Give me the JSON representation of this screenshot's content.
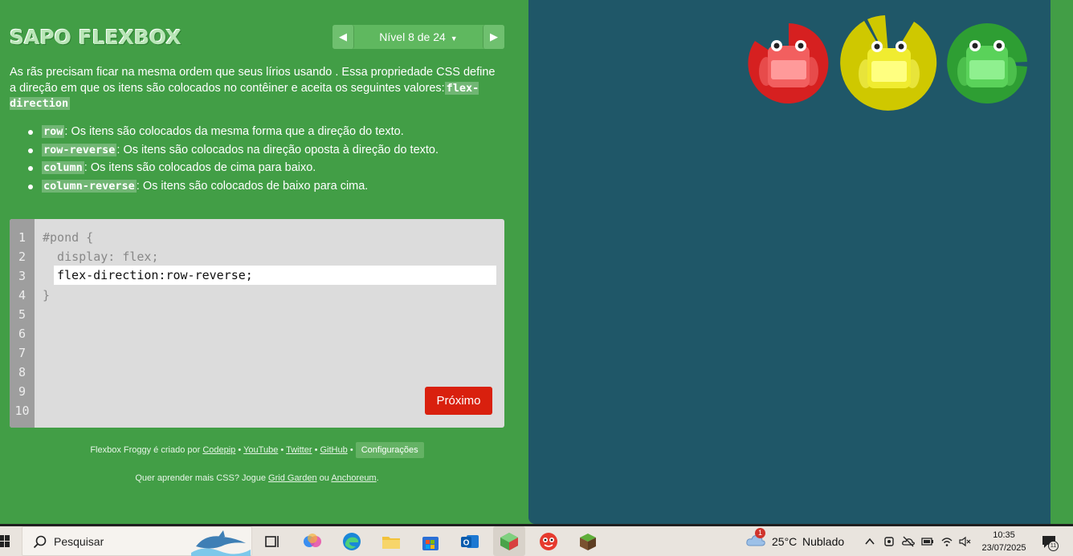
{
  "game": {
    "logo": "SAPO FLEXBOX",
    "level_label": "Nível 8 de 24",
    "instructions": {
      "part1": "As rãs precisam ficar na mesma ordem que seus lírios usando . Essa propriedade CSS define a direção em que os itens são colocados no contêiner e aceita os seguintes valores:",
      "keyword": "flex-direction"
    },
    "options": [
      {
        "code": "row",
        "desc": ": Os itens são colocados da mesma forma que a direção do texto."
      },
      {
        "code": "row-reverse",
        "desc": ": Os itens são colocados na direção oposta à direção do texto."
      },
      {
        "code": "column",
        "desc": ": Os itens são colocados de cima para baixo."
      },
      {
        "code": "column-reverse",
        "desc": ": Os itens são colocados de baixo para cima."
      }
    ],
    "editor": {
      "line_numbers": [
        "1",
        "2",
        "3",
        "4",
        "5",
        "6",
        "7",
        "8",
        "9",
        "10"
      ],
      "line1": "#pond {",
      "line2": "  display: flex;",
      "input_value": "flex-direction:row-reverse;",
      "line4": "}"
    },
    "next_button": "Próximo",
    "credits": {
      "prefix": "Flexbox Froggy é criado por",
      "codepip": "Codepip",
      "youtube": "YouTube",
      "twitter": "Twitter",
      "github": "GitHub",
      "sep": "•",
      "settings": "Configurações"
    },
    "more": {
      "prefix": "Quer aprender mais CSS? Jogue",
      "grid_garden": "Grid Garden",
      "or": "ou",
      "anchoreum": "Anchoreum",
      "suffix": "."
    },
    "frogs": [
      {
        "color": "red",
        "pad": "#e02020",
        "body": "#ff6f6f"
      },
      {
        "color": "yellow",
        "pad": "#d4d00a",
        "body": "#ffff5a"
      },
      {
        "color": "green",
        "pad": "#2f9d34",
        "body": "#6fe06f"
      }
    ]
  },
  "taskbar": {
    "search_placeholder": "Pesquisar",
    "weather_temp": "25°C",
    "weather_desc": "Nublado",
    "weather_badge": "1",
    "time": "10:35",
    "date": "23/07/2025",
    "notification_count": "11"
  }
}
